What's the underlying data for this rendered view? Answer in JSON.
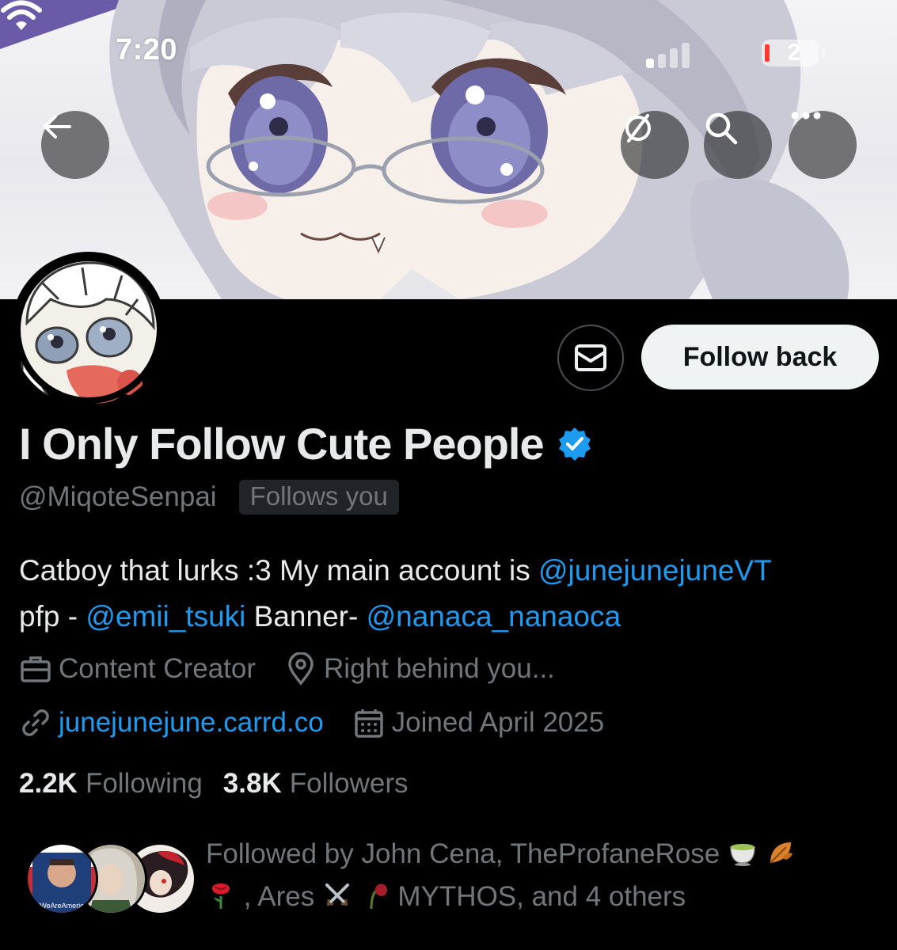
{
  "status_bar": {
    "time": "7:20",
    "battery_level": "2"
  },
  "banner": {
    "back_icon": "arrow-left-icon",
    "translate_icon": "no-translate-icon",
    "search_icon": "search-icon",
    "more_icon": "more-dots-icon"
  },
  "actions": {
    "message_icon": "envelope-icon",
    "follow_back_label": "Follow back"
  },
  "profile": {
    "display_name": "I Only Follow Cute People",
    "verified": true,
    "handle": "@MiqoteSenpai",
    "follows_you_label": "Follows you",
    "bio": {
      "line1_text": "Catboy that lurks :3 My main account is ",
      "line1_mention": "@junejunejuneVT",
      "line2_prefix": "pfp - ",
      "line2_mention1": "@emii_tsuki",
      "line2_middle": " Banner- ",
      "line2_mention2": "@nanaca_nanaoca"
    },
    "category": "Content Creator",
    "location": "Right behind you...",
    "website": "junejunejune.carrd.co",
    "joined": "Joined April 2025"
  },
  "stats": {
    "following_count": "2.2K",
    "following_label": "Following",
    "followers_count": "3.8K",
    "followers_label": "Followers"
  },
  "followed_by": {
    "prefix": "Followed by John Cena, TheProfaneRose",
    "part2": ", Ares",
    "part3": "MYTHOS, and 4 others",
    "avatar1_caption": "#WeAreAmerica"
  },
  "colors": {
    "link": "#1d9bf0",
    "muted": "#71767b",
    "verified": "#1d9bf0",
    "background": "#000000"
  }
}
